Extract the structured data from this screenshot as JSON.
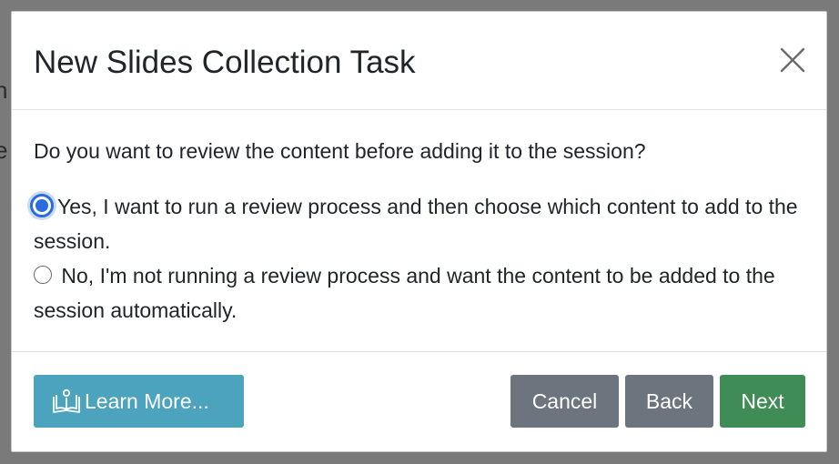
{
  "backdrop": {
    "fragment_1": "h",
    "fragment_2": "e"
  },
  "dialog": {
    "title": "New Slides Collection Task",
    "close_icon": "close-icon",
    "question": "Do you want to review the content before adding it to the session?",
    "options": [
      {
        "label": "Yes, I want to run a review process and then choose which content to add to the session.",
        "checked": true
      },
      {
        "label": "No, I'm not running a review process and want the content to be added to the session automatically.",
        "checked": false
      }
    ]
  },
  "footer": {
    "learn_more": {
      "label": "Learn More...",
      "icon": "book-icon"
    },
    "cancel": "Cancel",
    "back": "Back",
    "next": "Next"
  },
  "colors": {
    "accent_radio": "#2b6be0",
    "learn_more_bg": "#4ba3bd",
    "secondary_bg": "#6c757d",
    "next_bg": "#3f8c57"
  }
}
